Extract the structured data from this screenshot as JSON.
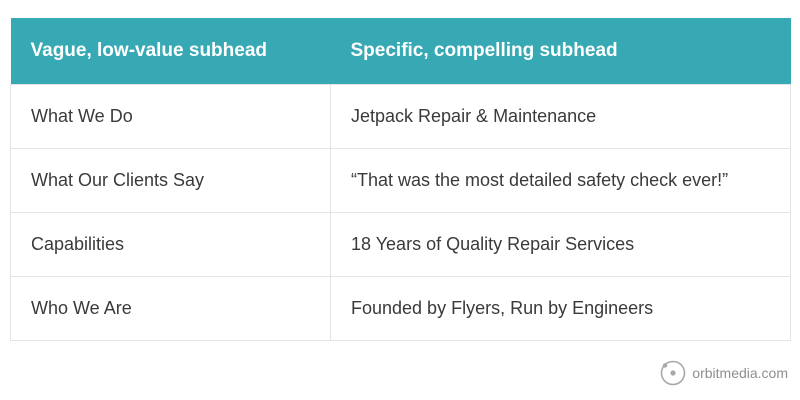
{
  "table": {
    "headers": [
      "Vague, low-value subhead",
      "Specific, compelling subhead"
    ],
    "rows": [
      [
        "What We Do",
        "Jetpack Repair & Maintenance"
      ],
      [
        "What Our Clients Say",
        "“That was the most detailed safety check ever!”"
      ],
      [
        "Capabilities",
        "18 Years of Quality Repair Services"
      ],
      [
        "Who We Are",
        "Founded by Flyers, Run by Engineers"
      ]
    ]
  },
  "branding": {
    "logo_text": "orbitmedia.com",
    "logo_icon": "orbit-icon"
  },
  "colors": {
    "header_background": "#36a9b4",
    "header_text": "#ffffff",
    "body_text": "#3a3a3a",
    "border": "#e4e4e4",
    "logo_text": "#8f8f8f"
  }
}
